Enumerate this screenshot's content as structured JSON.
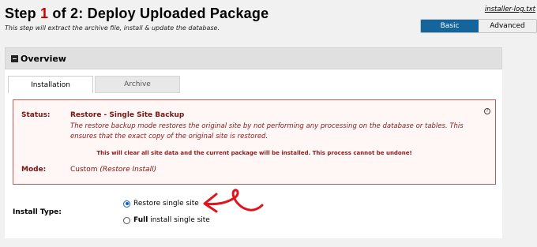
{
  "header": {
    "title_prefix": "Step ",
    "step_number": "1",
    "title_suffix": " of 2: Deploy Uploaded Package",
    "subtitle": "This step will extract the archive file, install & update the database.",
    "log_link": "installer-log.txt"
  },
  "mode_toggle": {
    "basic": "Basic",
    "advanced": "Advanced",
    "selected": "Basic"
  },
  "overview": {
    "title": "Overview",
    "tabs": [
      {
        "label": "Installation",
        "active": true
      },
      {
        "label": "Archive",
        "active": false
      }
    ],
    "status": {
      "label": "Status:",
      "value": "Restore - Single Site Backup",
      "description": "The restore backup mode restores the original site by not performing any processing on the database or tables. This ensures that the exact copy of the original site is restored.",
      "warning": "This will clear all site data and the current package will be installed. This process cannot be undone!",
      "mode_label": "Mode:",
      "mode_value": "Custom",
      "mode_detail": "(Restore Install)"
    },
    "install_type": {
      "label": "Install Type:",
      "options": [
        {
          "bold": "",
          "label": "Restore single site",
          "selected": true
        },
        {
          "bold": "Full",
          "label": "install single site",
          "selected": false
        }
      ]
    }
  },
  "colors": {
    "accent": "#13659c",
    "step_number": "#cc0000",
    "status_text": "#7b1313",
    "status_border": "#b06060",
    "arrow": "#e0141c"
  },
  "icons": {
    "overview": "minus-square-icon",
    "help": "question-circle-icon",
    "annotation": "red-arrow-annotation"
  }
}
